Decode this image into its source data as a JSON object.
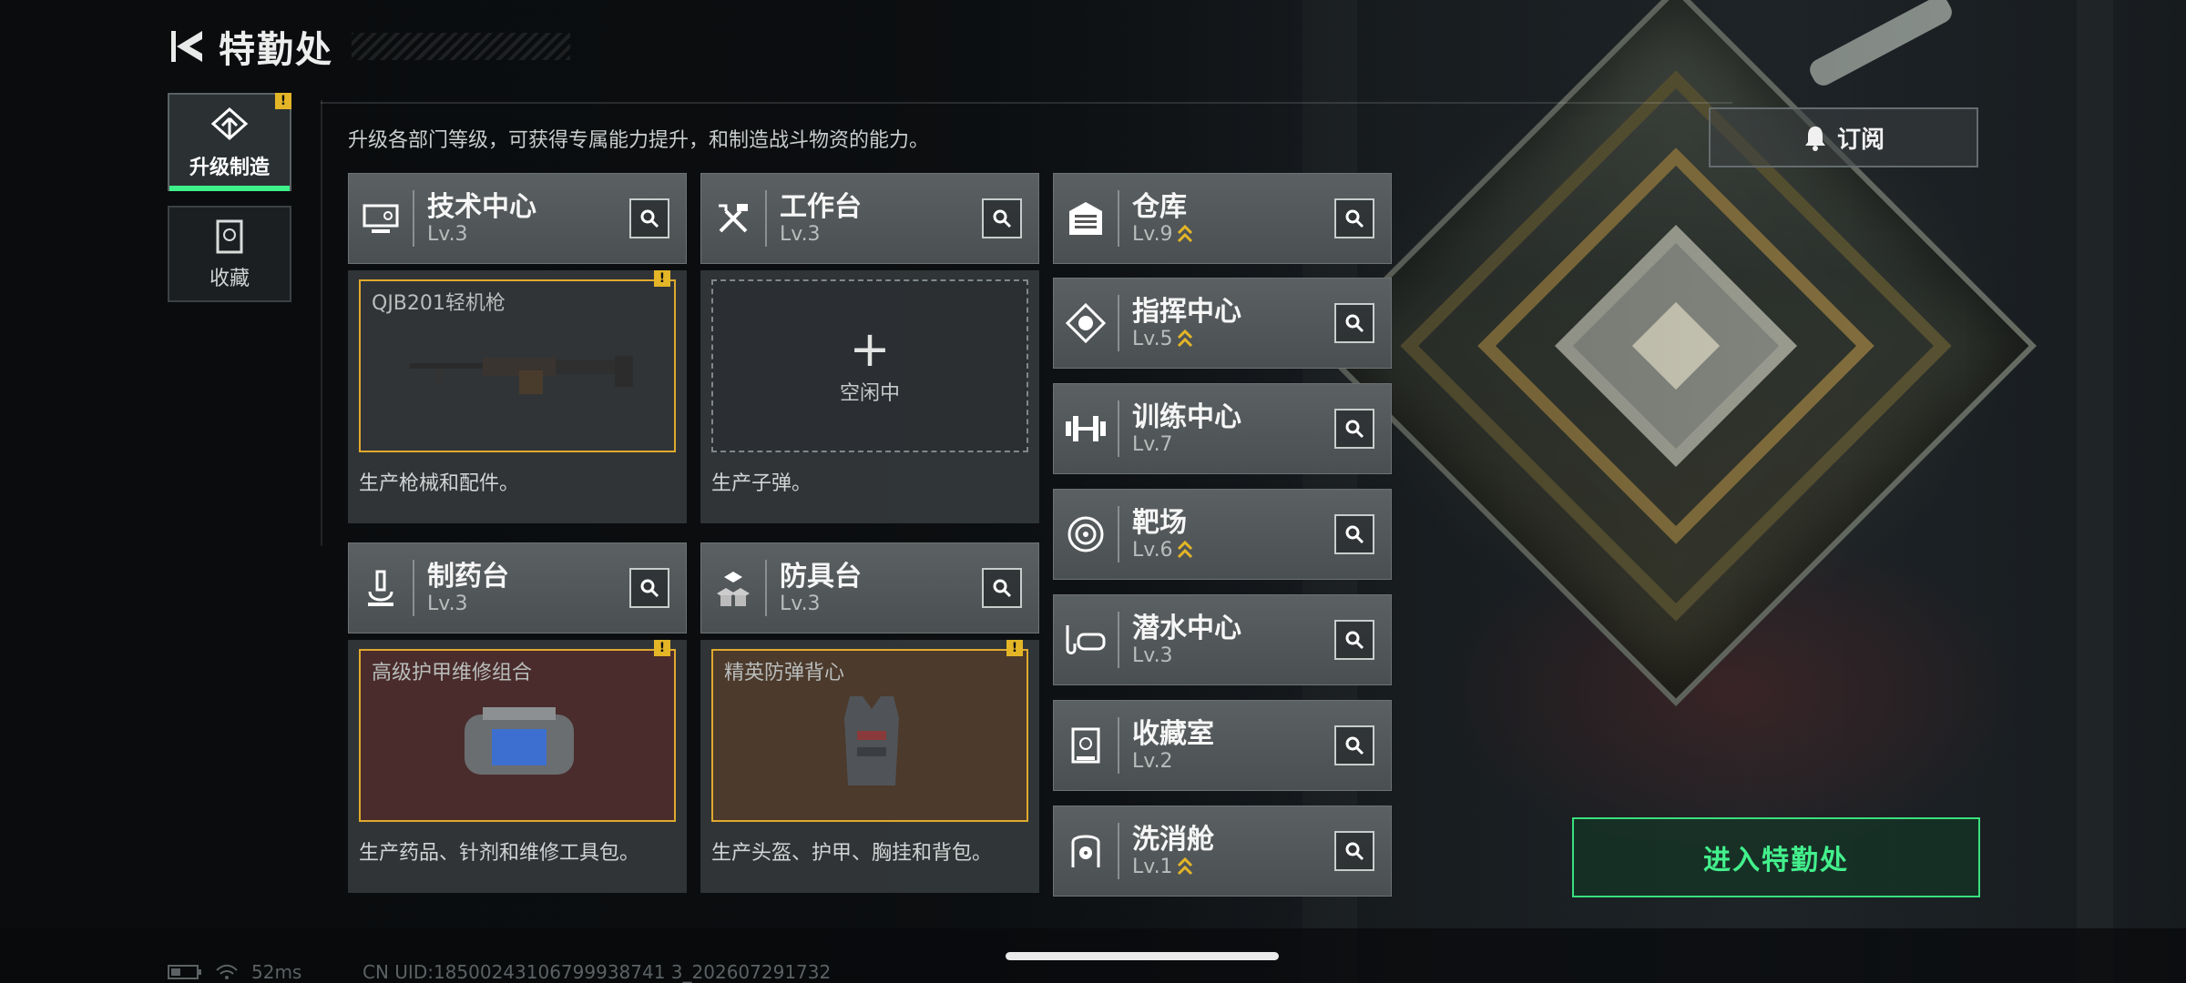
{
  "header": {
    "title": "特勤处"
  },
  "tabs": [
    {
      "label": "升级制造",
      "active": true,
      "alert": "!"
    },
    {
      "label": "收藏",
      "active": false
    }
  ],
  "description": "升级各部门等级，可获得专属能力提升，和制造战斗物资的能力。",
  "subscribe_label": "订阅",
  "departments": {
    "tech": {
      "name": "技术中心",
      "level": "Lv.3"
    },
    "workbench": {
      "name": "工作台",
      "level": "Lv.3"
    },
    "pharmacy": {
      "name": "制药台",
      "level": "Lv.3"
    },
    "armor": {
      "name": "防具台",
      "level": "Lv.3"
    },
    "warehouse": {
      "name": "仓库",
      "level": "Lv.9",
      "upgradable": true
    },
    "command": {
      "name": "指挥中心",
      "level": "Lv.5",
      "upgradable": true
    },
    "training": {
      "name": "训练中心",
      "level": "Lv.7"
    },
    "range": {
      "name": "靶场",
      "level": "Lv.6",
      "upgradable": true
    },
    "diving": {
      "name": "潜水中心",
      "level": "Lv.3"
    },
    "collection": {
      "name": "收藏室",
      "level": "Lv.2"
    },
    "decon": {
      "name": "洗消舱",
      "level": "Lv.1",
      "upgradable": true
    }
  },
  "production": {
    "tech": {
      "item": "QJB201轻机枪",
      "desc": "生产枪械和配件。",
      "alert": "!"
    },
    "workbench": {
      "plus": "+",
      "status": "空闲中",
      "desc": "生产子弹。"
    },
    "pharmacy": {
      "item": "高级护甲维修组合",
      "desc": "生产药品、针剂和维修工具包。",
      "alert": "!"
    },
    "armor": {
      "item": "精英防弹背心",
      "desc": "生产头盔、护甲、胸挂和背包。",
      "alert": "!"
    }
  },
  "enter_label": "进入特勤处",
  "status_bar": {
    "ping": "52ms",
    "uid": "CN UID:18500243106799938741 3_202607291732"
  },
  "colors": {
    "accent_green": "#3ef08a",
    "alert_yellow": "#e4b627",
    "slot_gold": "#e0a92e"
  }
}
